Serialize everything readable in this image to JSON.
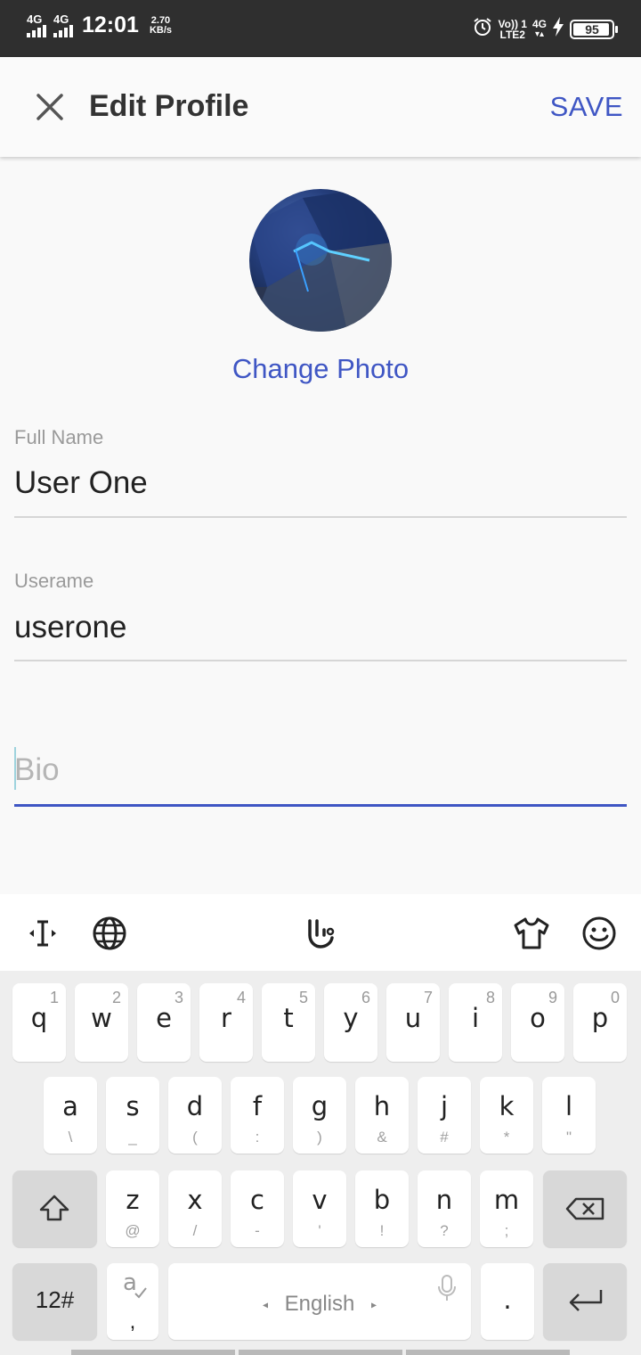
{
  "status_bar": {
    "sim1": "4G",
    "sim2": "4G",
    "time": "12:01",
    "speed_value": "2.70",
    "speed_unit": "KB/s",
    "volte": "Vo)) 1",
    "lte": "LTE2",
    "net": "4G",
    "battery": "95",
    "battery_level_percent": 95
  },
  "app_bar": {
    "title": "Edit Profile",
    "save_label": "SAVE",
    "close_icon": "close-icon"
  },
  "profile": {
    "change_photo_label": "Change Photo"
  },
  "form": {
    "full_name": {
      "label": "Full Name",
      "value": "User One"
    },
    "username": {
      "label": "Userame",
      "value": "userone"
    },
    "bio": {
      "placeholder": "Bio",
      "value": ""
    }
  },
  "keyboard": {
    "toolbar_icons": [
      "cursor-icon",
      "globe-icon",
      "touchpal-icon",
      "theme-icon",
      "emoji-icon"
    ],
    "row1": [
      {
        "k": "q",
        "n": "1"
      },
      {
        "k": "w",
        "n": "2"
      },
      {
        "k": "e",
        "n": "3"
      },
      {
        "k": "r",
        "n": "4"
      },
      {
        "k": "t",
        "n": "5"
      },
      {
        "k": "y",
        "n": "6"
      },
      {
        "k": "u",
        "n": "7"
      },
      {
        "k": "i",
        "n": "8"
      },
      {
        "k": "o",
        "n": "9"
      },
      {
        "k": "p",
        "n": "0"
      }
    ],
    "row2": [
      {
        "k": "a",
        "s": "\\"
      },
      {
        "k": "s",
        "s": "_"
      },
      {
        "k": "d",
        "s": "("
      },
      {
        "k": "f",
        "s": ":"
      },
      {
        "k": "g",
        "s": ")"
      },
      {
        "k": "h",
        "s": "&"
      },
      {
        "k": "j",
        "s": "#"
      },
      {
        "k": "k",
        "s": "*"
      },
      {
        "k": "l",
        "s": "\""
      }
    ],
    "row3": [
      {
        "k": "z",
        "s": "@"
      },
      {
        "k": "x",
        "s": "/"
      },
      {
        "k": "c",
        "s": "-"
      },
      {
        "k": "v",
        "s": "'"
      },
      {
        "k": "b",
        "s": "!"
      },
      {
        "k": "n",
        "s": "?"
      },
      {
        "k": "m",
        "s": ";"
      }
    ],
    "numbers_key": "12#",
    "comma_key": ",",
    "space_label": "English",
    "period_key": "."
  }
}
